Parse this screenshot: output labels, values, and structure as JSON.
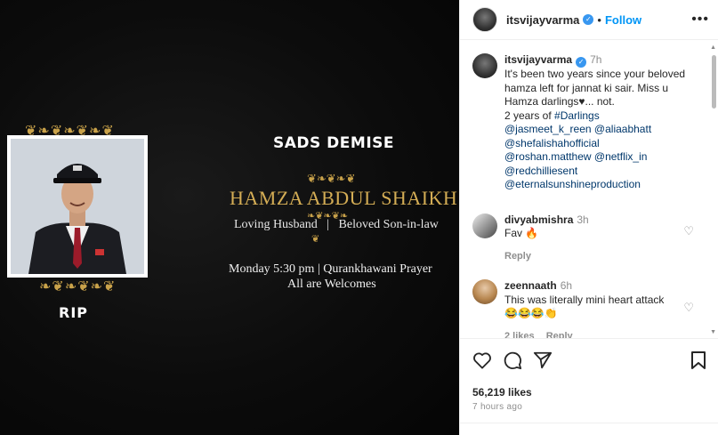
{
  "poster": {
    "demise": "SADS DEMISE",
    "name": "HAMZA ABDUL SHAIKH",
    "relation_left": "Loving Husband",
    "relation_sep": "|",
    "relation_right": "Beloved Son-in-law",
    "when": "Monday 5:30 pm |  Qurankhawani Prayer",
    "welcome": "All are Welcomes",
    "rip": "RIP"
  },
  "header": {
    "username": "itsvijayvarma",
    "separator": "•",
    "follow": "Follow",
    "more": "•••"
  },
  "caption": {
    "username": "itsvijayvarma",
    "time": "7h",
    "text": "It's been two years since your beloved hamza left for jannat ki sair. Miss u Hamza darlings♥... not.",
    "line2_prefix": "2 years of ",
    "hashtag": "#Darlings",
    "mentions": [
      "@jasmeet_k_reen",
      "@aliaabhatt",
      "@shefalishahofficial",
      "@roshan.matthew",
      "@netflix_in",
      "@redchilliesent",
      "@eternalsunshineproduction"
    ]
  },
  "comments": [
    {
      "username": "divyabmishra",
      "time": "3h",
      "text": "Fav 🔥",
      "reply": "Reply",
      "likes": ""
    },
    {
      "username": "zeennaath",
      "time": "6h",
      "text": "This was literally mini heart attack",
      "emojis": "😂😂😂👏",
      "likes": "2 likes",
      "reply": "Reply"
    }
  ],
  "stats": {
    "likes": "56,219 likes",
    "ago": "7 hours ago"
  },
  "colors": {
    "accent": "#0095f6",
    "gold": "#c9a24a"
  }
}
